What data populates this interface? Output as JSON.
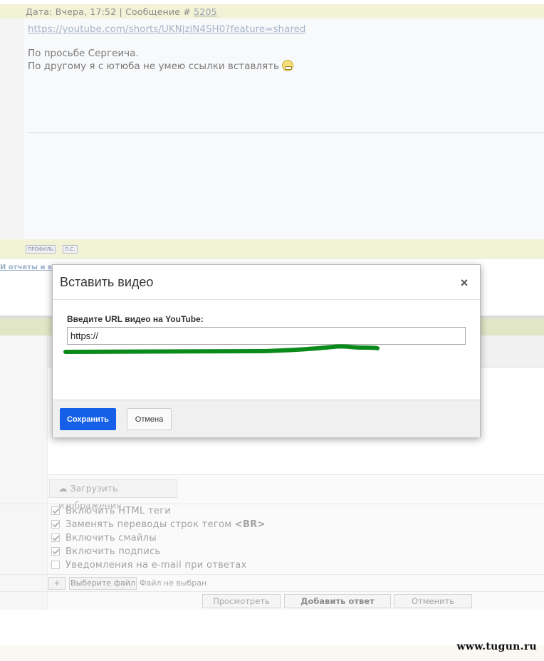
{
  "post": {
    "meta_prefix": "Дата: Вчера, 17:52 | Сообщение # ",
    "message_number": "5205",
    "link": "https://youtube.com/shorts/UKNjziN4SH0?feature=shared",
    "line1": "По просьбе Сергеича.",
    "line2": "По другому я с ютюба не умею ссылки вставлять",
    "smiley_icon": "grin-smiley-icon",
    "buttons": {
      "profile": "ПРОФИЛЬ",
      "pm": "Л.С."
    }
  },
  "breadcrumb_fragment": "И отчеты и к",
  "modal": {
    "title": "Вставить видео",
    "close_glyph": "×",
    "label": "Введите URL видео на YouTube:",
    "url_value": "https://",
    "save_label": "Сохранить",
    "cancel_label": "Отмена",
    "annotation_color": "#0a8a1a"
  },
  "form": {
    "upload_label": "Загрузить изображения",
    "options": [
      {
        "label": "Включить HTML теги",
        "checked": true
      },
      {
        "label": "Заменять переводы строк тегом ",
        "tag": "<BR>",
        "checked": true
      },
      {
        "label": "Включить смайлы",
        "checked": true
      },
      {
        "label": "Включить подпись",
        "checked": true
      },
      {
        "label": "Уведомления на e-mail при ответах",
        "checked": false
      }
    ],
    "plus_label": "+",
    "choose_file_label": "Выберите файл",
    "no_file_label": "Файл не выбран",
    "preview_label": "Просмотреть",
    "submit_label": "Добавить ответ",
    "cancel_label": "Отменить"
  },
  "watermark": "www.tugun.ru",
  "colors": {
    "primary": "#1560e6",
    "post_header": "#f2f3d6",
    "green_band": "#e0e6c6"
  }
}
